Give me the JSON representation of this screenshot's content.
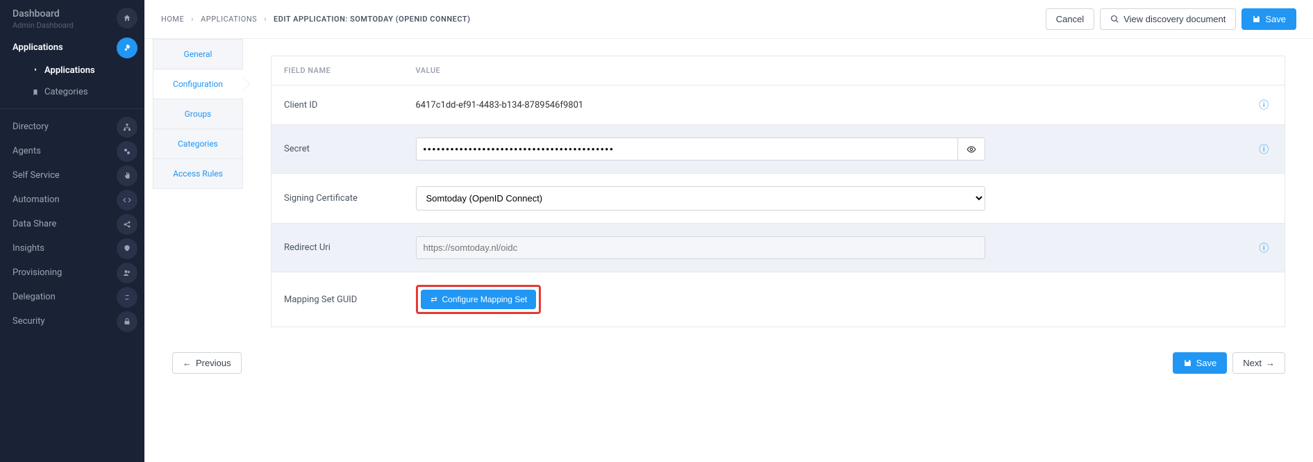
{
  "sidebar": {
    "dashboard": {
      "title": "Dashboard",
      "subtitle": "Admin Dashboard"
    },
    "applications": {
      "label": "Applications"
    },
    "sub": {
      "applications": "Applications",
      "categories": "Categories"
    },
    "nav": [
      {
        "label": "Directory"
      },
      {
        "label": "Agents"
      },
      {
        "label": "Self Service"
      },
      {
        "label": "Automation"
      },
      {
        "label": "Data Share"
      },
      {
        "label": "Insights"
      },
      {
        "label": "Provisioning"
      },
      {
        "label": "Delegation"
      },
      {
        "label": "Security"
      }
    ]
  },
  "breadcrumb": {
    "home": "HOME",
    "applications": "APPLICATIONS",
    "current": "EDIT APPLICATION: SOMTODAY (OPENID CONNECT)"
  },
  "actions": {
    "cancel": "Cancel",
    "discovery": "View discovery document",
    "save": "Save"
  },
  "tabs": [
    "General",
    "Configuration",
    "Groups",
    "Categories",
    "Access Rules"
  ],
  "table": {
    "headers": {
      "field": "FIELD NAME",
      "value": "VALUE"
    },
    "rows": {
      "clientid": {
        "label": "Client ID",
        "value": "6417c1dd-ef91-4483-b134-8789546f9801"
      },
      "secret": {
        "label": "Secret",
        "value": "••••••••••••••••••••••••••••••••••••••••••"
      },
      "signing": {
        "label": "Signing Certificate",
        "value": "Somtoday (OpenID Connect)"
      },
      "redirect": {
        "label": "Redirect Uri",
        "placeholder": "https://somtoday.nl/oidc"
      },
      "mapping": {
        "label": "Mapping Set GUID",
        "button": "Configure Mapping Set"
      }
    }
  },
  "footer": {
    "previous": "Previous",
    "save": "Save",
    "next": "Next"
  }
}
